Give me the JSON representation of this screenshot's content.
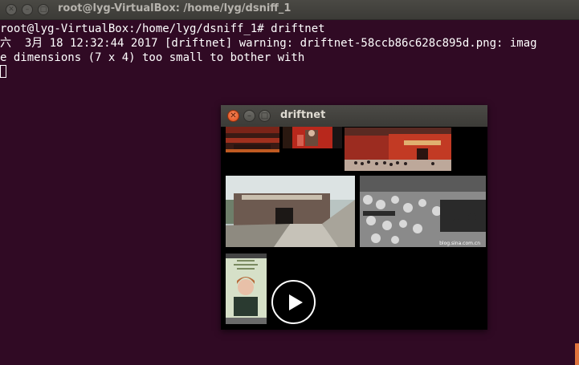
{
  "terminal": {
    "title": "root@lyg-VirtualBox: /home/lyg/dsniff_1",
    "lines": [
      "root@lyg-VirtualBox:/home/lyg/dsniff_1# driftnet",
      "六  3月 18 12:32:44 2017 [driftnet] warning: driftnet-58ccb86c628c895d.png: imag",
      "e dimensions (7 x 4) too small to bother with"
    ]
  },
  "driftnet": {
    "title": "driftnet",
    "thumbnails": [
      "thumb-red-stage-top-left",
      "thumb-red-stage-top-middle",
      "thumb-red-building-crowd",
      "thumb-memorial-hall-entrance",
      "thumb-crowd-black-white",
      "thumb-phone-screen-portrait"
    ],
    "bw_watermark": "blog.sina.com.cn"
  },
  "colors": {
    "terminal_bg": "#300a24",
    "terminal_fg": "#ffffff",
    "titlebar": "#3c3b37",
    "close_orange": "#df4a16"
  },
  "icons": {
    "close": "close-icon",
    "minimize": "minimize-icon",
    "maximize": "maximize-icon",
    "play": "play-icon"
  }
}
